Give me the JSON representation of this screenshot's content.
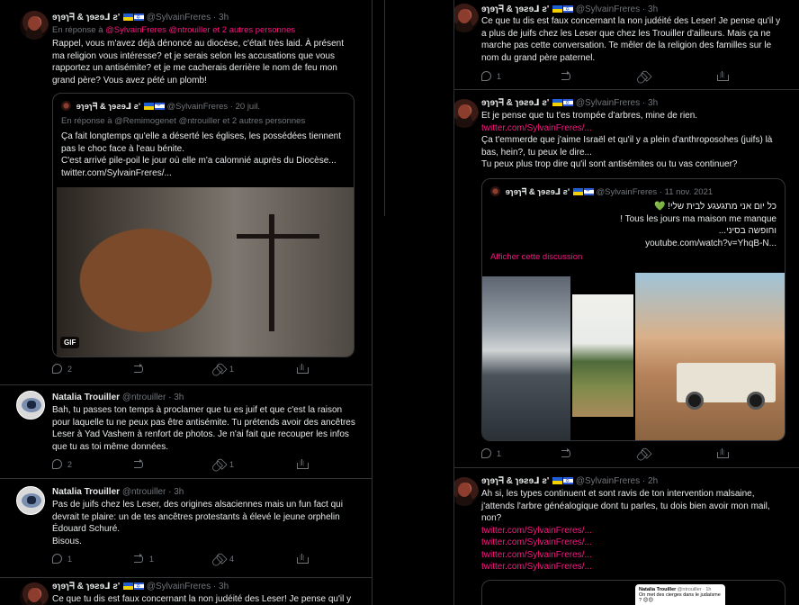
{
  "user_sylvain": {
    "name": "ɘɿɘɿᖷ & ɿɘƨɘ⅃ ƨ'",
    "handle": "@SylvainFreres"
  },
  "user_natalia": {
    "name": "Natalia Trouiller",
    "handle": "@ntrouiller"
  },
  "dot": "·",
  "left": {
    "t1": {
      "time": "3h",
      "reply_prefix": "En réponse à",
      "reply_mentions": "@SylvainFreres @ntrouiller",
      "reply_others": "et 2 autres personnes",
      "text": "Rappel, vous m'avez déjà dénoncé au diocèse, c'était très laid. À présent ma religion vous intéresse? et je serais selon les accusations que vous rapportez un antisémite? et je me cacherais derrière le nom de feu mon grand père? Vous avez pété un plomb!",
      "quote": {
        "time": "20 juil.",
        "reply_prefix": "En réponse à",
        "reply_mentions": "@Remimogenet @ntrouiller",
        "reply_others": "et 2 autres personnes",
        "line1": "Ça fait longtemps qu'elle a déserté les églises, les possédées tiennent pas le choc face à l'eau bénite.",
        "line2": "C'est arrivé pile-poil le jour où elle m'a calomnié auprès du Diocèse...",
        "link": "twitter.com/SylvainFreres/...",
        "gif_label": "GIF"
      },
      "replies": "2",
      "retweets": "",
      "likes": "1"
    },
    "t2": {
      "time": "3h",
      "text": "Bah, tu passes ton temps à proclamer que tu es juif et que c'est la raison pour laquelle tu ne peux pas être antisémite. Tu prétends avoir des ancêtres Leser à Yad Vashem à renfort de photos. Je n'ai fait que recouper les infos que tu as toi même données.",
      "replies": "2",
      "retweets": "",
      "likes": "1"
    },
    "t3": {
      "time": "3h",
      "text": "Pas de juifs chez les Leser, des origines alsaciennes mais un fun fact qui devrait te plaire: un de tes ancêtres protestants à élevé le jeune orphelin Édouard Schuré.",
      "text2": "Bisous.",
      "replies": "1",
      "retweets": "1",
      "likes": "4"
    },
    "t4": {
      "time": "3h",
      "text": "Ce que tu dis est faux concernant la non judéité des Leser! Je pense qu'il y"
    }
  },
  "right": {
    "t1": {
      "time": "3h",
      "text": "Ce que tu dis est faux concernant la non judéité des Leser! Je pense qu'il y a plus de juifs chez les Leser que chez les Trouiller d'ailleurs. Mais ça ne marche pas cette conversation. Te mêler de la religion des familles sur le nom du grand père paternel.",
      "replies": "1",
      "retweets": "",
      "likes": ""
    },
    "t2": {
      "time": "3h",
      "line1": "Et je pense que tu t'es trompée d'arbres, mine de rien.",
      "link": "twitter.com/SylvainFreres/...",
      "line2": "Ça t'emmerde que j'aime Israël et qu'il y a plein d'anthroposohes (juifs) là bas, hein?, tu peux le dire...",
      "line3": "Tu peux plus trop dire qu'il sont antisémites ou tu vas continuer?",
      "quote": {
        "time": "11 nov. 2021",
        "he1": "כל יום אני מתגעגע לבית שלי! 💚",
        "fr1": "! Tous les jours ma maison me manque",
        "he2": "וחופשה בסיני...",
        "link": "youtube.com/watch?v=YhqB-N...",
        "show_thread": "Afficher cette discussion"
      },
      "replies": "1",
      "retweets": "",
      "likes": ""
    },
    "t3": {
      "time": "2h",
      "text": "Ah si, les types continuent et sont ravis de ton intervention malsaine, j'attends l'arbre généalogique dont tu parles, tu dois bien avoir mon mail, non?",
      "links": [
        "twitter.com/SylvainFreres/...",
        "twitter.com/SylvainFreres/...",
        "twitter.com/SylvainFreres/...",
        "twitter.com/SylvainFreres/..."
      ],
      "mini": {
        "name": "Natalia Trouiller",
        "handle": "@ntrouiller · 1h",
        "text": "On met des cierges dans le judaïsme ? 😊😊"
      }
    }
  }
}
